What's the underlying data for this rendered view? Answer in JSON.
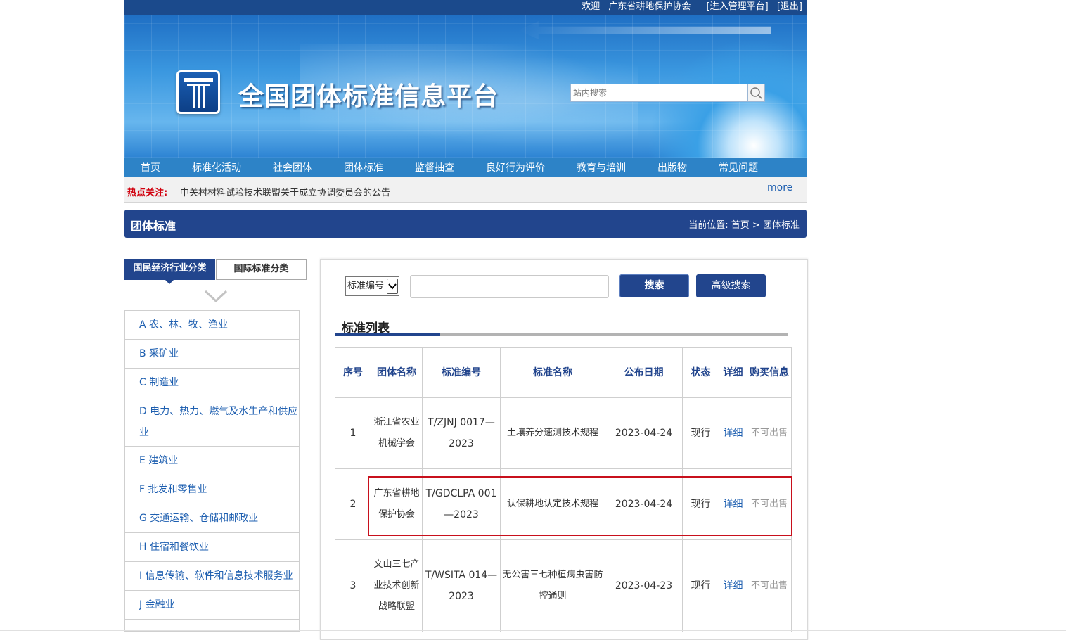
{
  "topbar": {
    "welcome": "欢迎",
    "org": "广东省耕地保护协会",
    "admin_link": "[进入管理平台]",
    "logout_link": "[退出]"
  },
  "header": {
    "site_title": "全国团体标准信息平台",
    "search_placeholder": "站内搜索",
    "icon": "search-icon"
  },
  "nav": {
    "items": [
      {
        "label": "首页"
      },
      {
        "label": "标准化活动"
      },
      {
        "label": "社会团体"
      },
      {
        "label": "团体标准"
      },
      {
        "label": "监督抽查"
      },
      {
        "label": "良好行为评价"
      },
      {
        "label": "教育与培训"
      },
      {
        "label": "出版物"
      },
      {
        "label": "常见问题"
      }
    ]
  },
  "hot": {
    "label": "热点关注:",
    "text": "中关村材料试验技术联盟关于成立协调委员会的公告",
    "more": "more"
  },
  "section": {
    "title": "团体标准",
    "breadcrumb_prefix": "当前位置:",
    "breadcrumb_home": "首页",
    "breadcrumb_sep": ">",
    "breadcrumb_current": "团体标准"
  },
  "sidebar": {
    "tabs": [
      {
        "label": "国民经济行业分类",
        "active": true
      },
      {
        "label": "国际标准分类",
        "active": false
      }
    ],
    "categories": [
      {
        "label": "A 农、林、牧、渔业"
      },
      {
        "label": "B 采矿业"
      },
      {
        "label": "C 制造业"
      },
      {
        "label": "D 电力、热力、燃气及水生产和供应业"
      },
      {
        "label": "E 建筑业"
      },
      {
        "label": "F 批发和零售业"
      },
      {
        "label": "G 交通运输、仓储和邮政业"
      },
      {
        "label": "H 住宿和餐饮业"
      },
      {
        "label": "I 信息传输、软件和信息技术服务业"
      },
      {
        "label": "J 金融业"
      }
    ]
  },
  "search": {
    "select_value": "标准编号",
    "search_button": "搜索",
    "advanced_button": "高级搜索"
  },
  "list": {
    "title": "标准列表",
    "columns": [
      "序号",
      "团体名称",
      "标准编号",
      "标准名称",
      "公布日期",
      "状态",
      "详细",
      "购买信息"
    ],
    "rows": [
      {
        "no": "1",
        "org": "浙江省农业机械学会",
        "code": "T/ZJNJ 0017—2023",
        "name": "土壤养分速测技术规程",
        "date": "2023-04-24",
        "status": "现行",
        "detail": "详细",
        "buy": "不可出售"
      },
      {
        "no": "2",
        "org": "广东省耕地保护协会",
        "code": "T/GDCLPA 001—2023",
        "name": "认保耕地认定技术规程",
        "date": "2023-04-24",
        "status": "现行",
        "detail": "详细",
        "buy": "不可出售"
      },
      {
        "no": "3",
        "org": "文山三七产业技术创新战略联盟",
        "code": "T/WSITA 014—2023",
        "name": "无公害三七种植病虫害防控通则",
        "date": "2023-04-23",
        "status": "现行",
        "detail": "详细",
        "buy": "不可出售"
      }
    ]
  },
  "colors": {
    "primary": "#22458d",
    "nav": "#2d83c7",
    "link": "#1e5fb0",
    "hot_label": "#d1000e",
    "highlight_box": "#c8101c"
  }
}
